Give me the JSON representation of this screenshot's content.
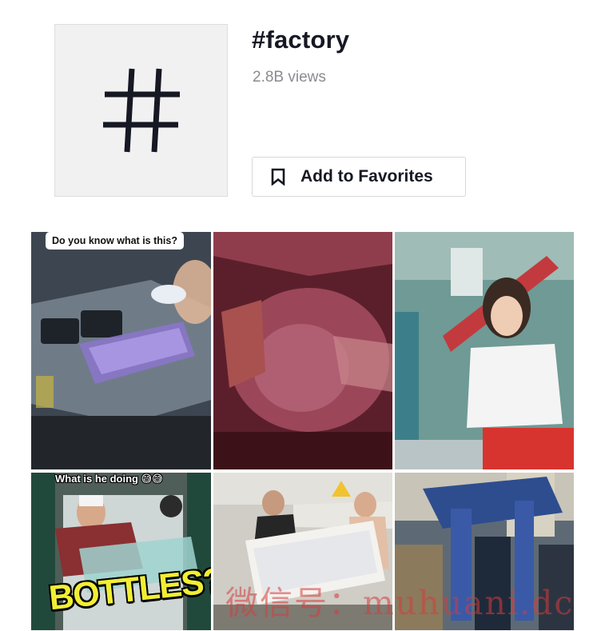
{
  "header": {
    "icon": "hashtag-icon",
    "title": "#factory",
    "views": "2.8B views",
    "favorite_button": {
      "label": "Add to Favorites",
      "icon": "bookmark-icon"
    }
  },
  "videos": [
    {
      "caption": "Do you know what is this?",
      "overlay_text": ""
    },
    {
      "caption": "",
      "overlay_text": ""
    },
    {
      "caption": "",
      "overlay_text": ""
    },
    {
      "caption": "What is he doing 😅😅",
      "overlay_text": "BOTTLES?"
    },
    {
      "caption": "",
      "overlay_text": ""
    },
    {
      "caption": "",
      "overlay_text": ""
    }
  ],
  "watermark": "微信号：muhuani.dc",
  "colors": {
    "text_primary": "#161823",
    "text_secondary": "#8a8b91",
    "thumb_bg": "#f1f1f2"
  }
}
